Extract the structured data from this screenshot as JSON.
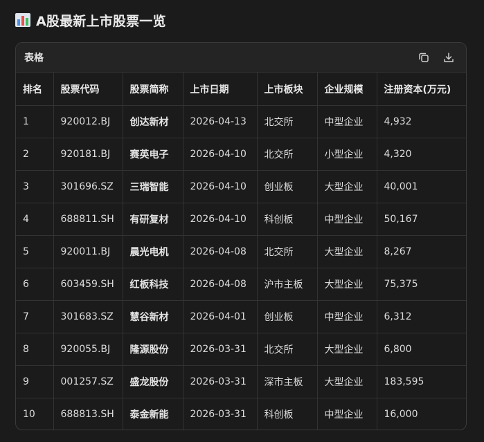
{
  "page": {
    "title": "A股最新上市股票一览",
    "title_icon": "bar-chart-icon"
  },
  "panel": {
    "label": "表格",
    "actions": [
      {
        "icon": "copy-icon"
      },
      {
        "icon": "download-icon"
      }
    ]
  },
  "table": {
    "headers": [
      "排名",
      "股票代码",
      "股票简称",
      "上市日期",
      "上市板块",
      "企业规模",
      "注册资本(万元)"
    ],
    "rows": [
      [
        "1",
        "920012.BJ",
        "创达新材",
        "2026-04-13",
        "北交所",
        "中型企业",
        "4,932"
      ],
      [
        "2",
        "920181.BJ",
        "赛英电子",
        "2026-04-10",
        "北交所",
        "小型企业",
        "4,320"
      ],
      [
        "3",
        "301696.SZ",
        "三瑞智能",
        "2026-04-10",
        "创业板",
        "大型企业",
        "40,001"
      ],
      [
        "4",
        "688811.SH",
        "有研复材",
        "2026-04-10",
        "科创板",
        "中型企业",
        "50,167"
      ],
      [
        "5",
        "920011.BJ",
        "晨光电机",
        "2026-04-08",
        "北交所",
        "大型企业",
        "8,267"
      ],
      [
        "6",
        "603459.SH",
        "红板科技",
        "2026-04-08",
        "沪市主板",
        "大型企业",
        "75,375"
      ],
      [
        "7",
        "301683.SZ",
        "慧谷新材",
        "2026-04-01",
        "创业板",
        "中型企业",
        "6,312"
      ],
      [
        "8",
        "920055.BJ",
        "隆源股份",
        "2026-03-31",
        "北交所",
        "大型企业",
        "6,800"
      ],
      [
        "9",
        "001257.SZ",
        "盛龙股份",
        "2026-03-31",
        "深市主板",
        "大型企业",
        "183,595"
      ],
      [
        "10",
        "688813.SH",
        "泰金新能",
        "2026-03-31",
        "科创板",
        "中型企业",
        "16,000"
      ]
    ]
  },
  "colors": {
    "background": "#1b1b1b",
    "panel_header": "#242424",
    "border": "#333333",
    "text": "#dcdcdc",
    "icon_bar_blue": "#4a8fe8",
    "icon_bar_green": "#3fbf5f",
    "icon_bar_red": "#e8504a",
    "icon_bg": "#dfe6ef"
  }
}
